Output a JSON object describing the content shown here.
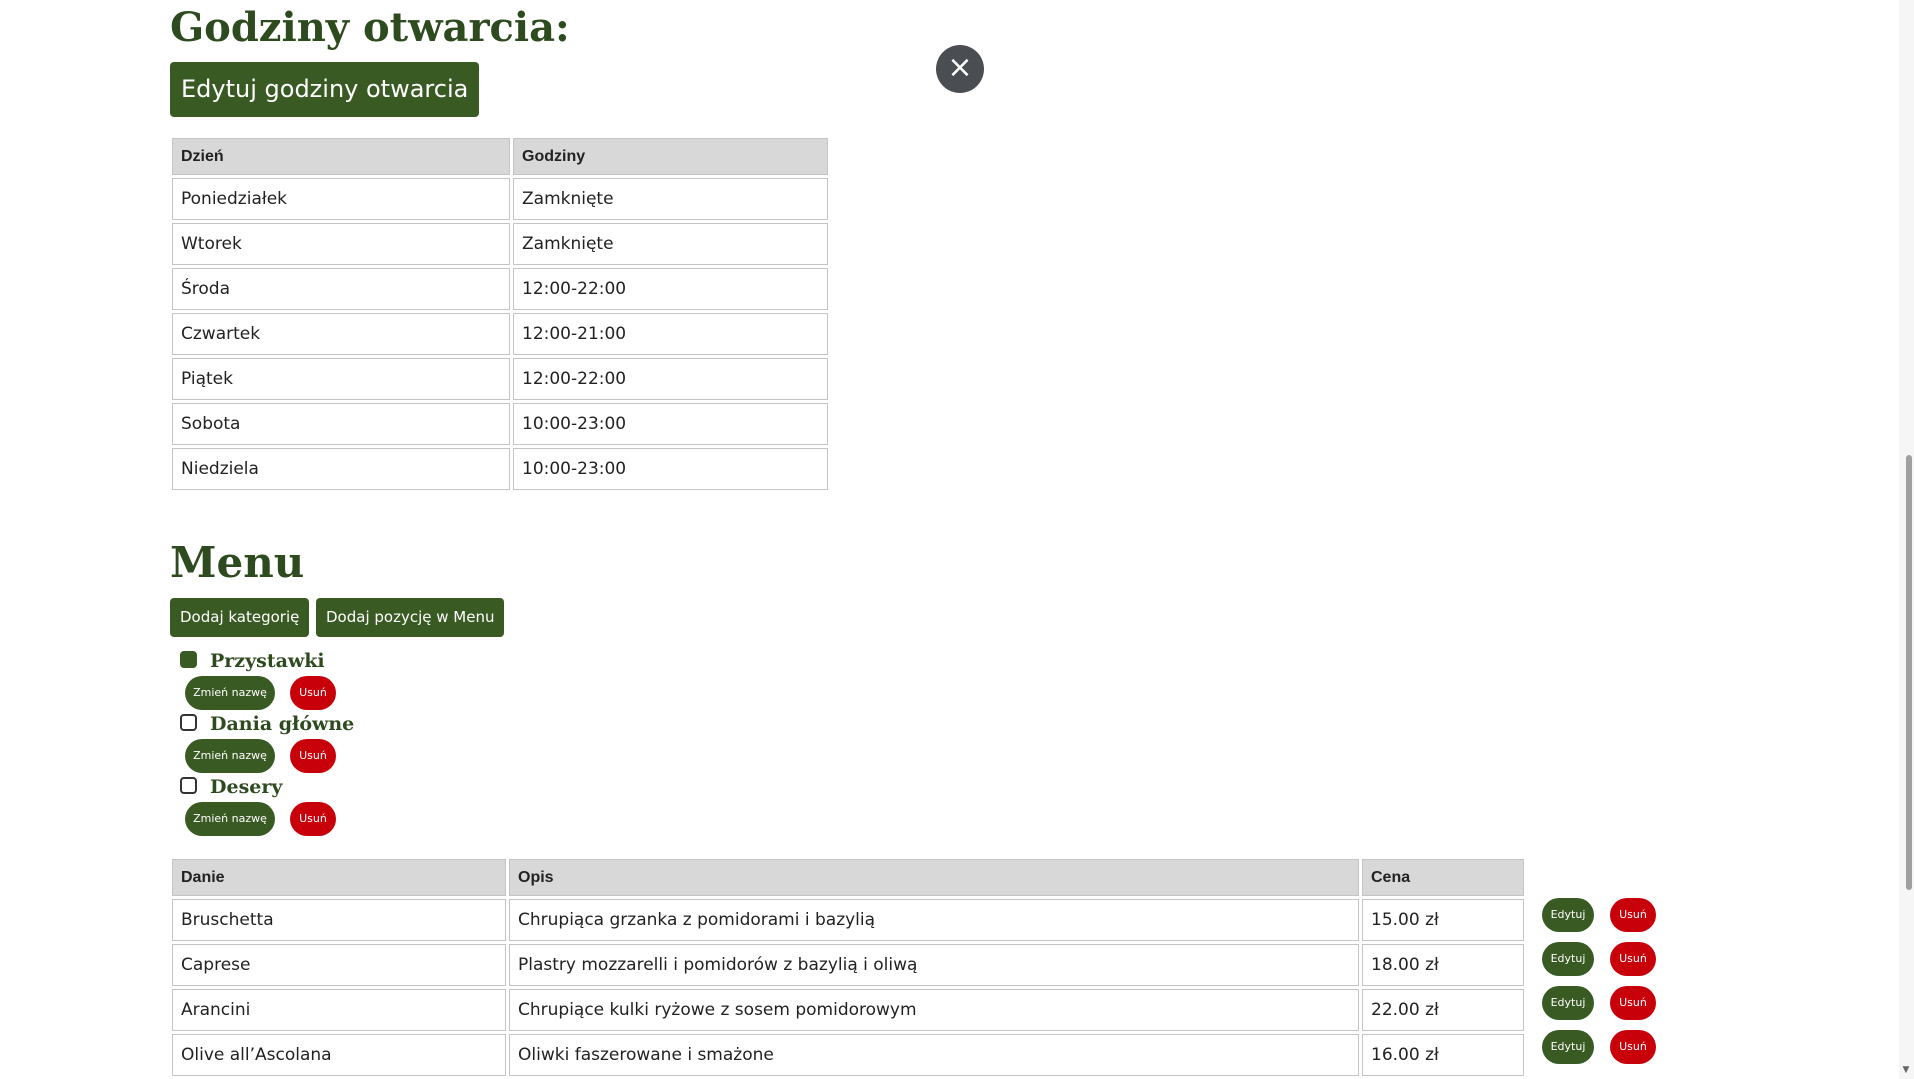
{
  "hours_section": {
    "title": "Godziny otwarcia:",
    "edit_button": "Edytuj godziny otwarcia",
    "close_icon": "close-icon",
    "headers": [
      "Dzień",
      "Godziny"
    ],
    "rows": [
      {
        "day": "Poniedziałek",
        "hours": "Zamknięte"
      },
      {
        "day": "Wtorek",
        "hours": "Zamknięte"
      },
      {
        "day": "Środa",
        "hours": "12:00-22:00"
      },
      {
        "day": "Czwartek",
        "hours": "12:00-21:00"
      },
      {
        "day": "Piątek",
        "hours": "12:00-22:00"
      },
      {
        "day": "Sobota",
        "hours": "10:00-23:00"
      },
      {
        "day": "Niedziela",
        "hours": "10:00-23:00"
      }
    ]
  },
  "menu_section": {
    "title": "Menu",
    "add_category_button": "Dodaj kategorię",
    "add_item_button": "Dodaj pozycję w Menu",
    "categories": [
      {
        "name": "Przystawki",
        "checked": true,
        "rename": "Zmień nazwę",
        "delete": "Usuń"
      },
      {
        "name": "Dania główne",
        "checked": false,
        "rename": "Zmień nazwę",
        "delete": "Usuń"
      },
      {
        "name": "Desery",
        "checked": false,
        "rename": "Zmień nazwę",
        "delete": "Usuń"
      }
    ],
    "headers": [
      "Danie",
      "Opis",
      "Cena"
    ],
    "items": [
      {
        "name": "Bruschetta",
        "desc": "Chrupiąca grzanka z pomidorami i bazylią",
        "price": "15.00 zł",
        "edit": "Edytuj",
        "delete": "Usuń"
      },
      {
        "name": "Caprese",
        "desc": "Plastry mozzarelli i pomidorów z bazylią i oliwą",
        "price": "18.00 zł",
        "edit": "Edytuj",
        "delete": "Usuń"
      },
      {
        "name": "Arancini",
        "desc": "Chrupiące kulki ryżowe z sosem pomidorowym",
        "price": "22.00 zł",
        "edit": "Edytuj",
        "delete": "Usuń"
      },
      {
        "name": "Olive all’Ascolana",
        "desc": "Oliwki faszerowane i smażone",
        "price": "16.00 zł",
        "edit": "Edytuj",
        "delete": "Usuń"
      }
    ]
  },
  "colors": {
    "primary_green": "#3a5a24",
    "heading_green": "#2e4a1f",
    "danger_red": "#c8000a",
    "header_gray": "#d8d8d8"
  }
}
